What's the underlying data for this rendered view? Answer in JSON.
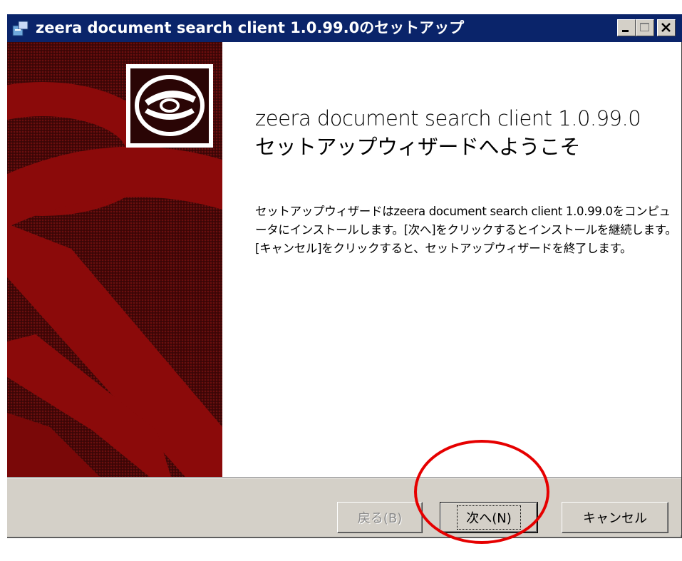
{
  "window": {
    "title": "zeera document search client 1.0.99.0のセットアップ",
    "icon": "installer-icon",
    "controls": {
      "minimize_icon": "minimize-icon",
      "maximize_icon": "maximize-icon",
      "close_icon": "close-icon"
    }
  },
  "banner": {
    "logo_icon": "cd-disc-icon"
  },
  "main": {
    "heading": "zeera document search client 1.0.99.0 セットアップウィザードへようこそ",
    "description": "セットアップウィザードはzeera document search client 1.0.99.0をコンピュータにインストールします。[次へ]をクリックするとインストールを継続します。[キャンセル]をクリックすると、セットアップウィザードを終了します。"
  },
  "buttons": {
    "back": "戻る(B)",
    "next": "次へ(N)",
    "cancel": "キャンセル"
  },
  "colors": {
    "titlebar": "#0a246a",
    "banner_dark": "#3a0606",
    "banner_red": "#8b0a0a",
    "annotation": "#e60000"
  }
}
